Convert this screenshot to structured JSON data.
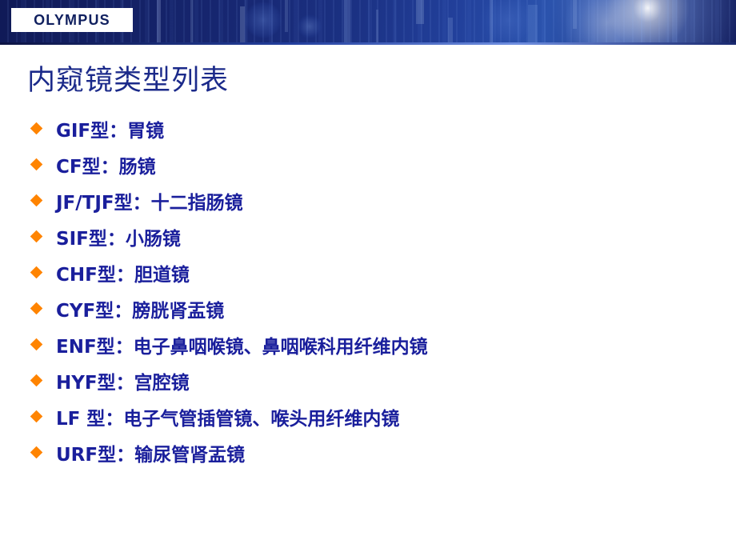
{
  "banner": {
    "logo_text": "OLYMPUS",
    "logo_color": "#ffffff",
    "background_color": "#121f63"
  },
  "slide": {
    "title": "内窥镜类型列表",
    "title_color": "#1b2a8a",
    "bullet_color": "#ff8400",
    "text_color": "#1a1f9c",
    "bullets": [
      {
        "label": "GIF型：胃镜"
      },
      {
        "label": "CF型：肠镜"
      },
      {
        "label": "JF/TJF型：十二指肠镜"
      },
      {
        "label": "SIF型：小肠镜"
      },
      {
        "label": "CHF型：胆道镜"
      },
      {
        "label": "CYF型：膀胱肾盂镜"
      },
      {
        "label": "ENF型：电子鼻咽喉镜、鼻咽喉科用纤维内镜"
      },
      {
        "label": "HYF型：宫腔镜"
      },
      {
        "label": "LF 型：电子气管插管镜、喉头用纤维内镜"
      },
      {
        "label": "URF型：输尿管肾盂镜"
      }
    ]
  }
}
